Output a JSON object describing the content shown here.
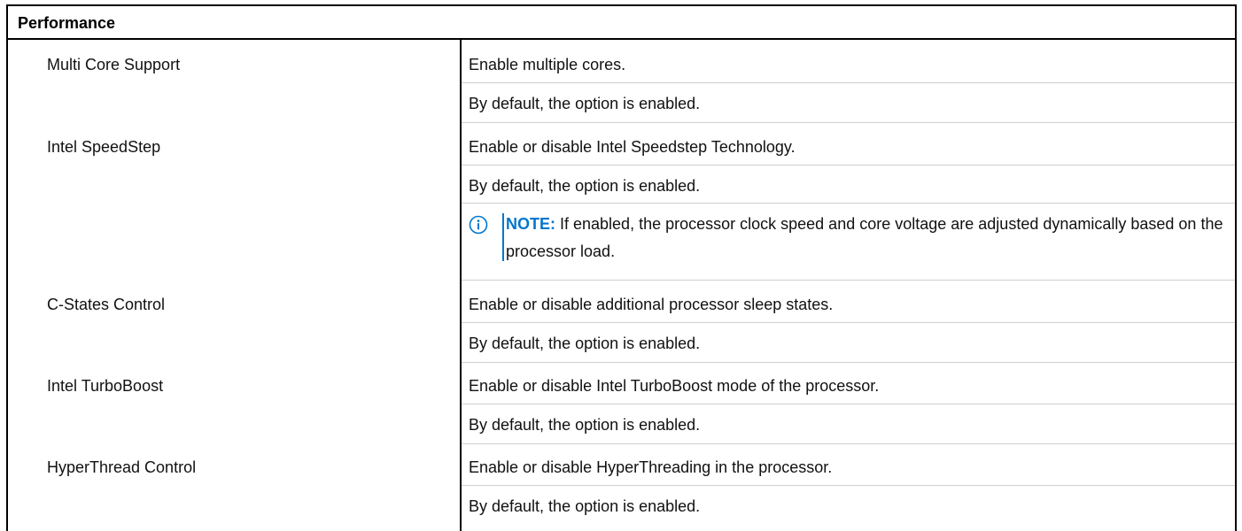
{
  "table": {
    "header": "Performance",
    "rows": [
      {
        "label": "Multi Core Support",
        "lines": [
          "Enable multiple cores.",
          "By default, the option is enabled."
        ]
      },
      {
        "label": "Intel SpeedStep",
        "lines": [
          "Enable or disable Intel Speedstep Technology.",
          "By default, the option is enabled."
        ],
        "note": {
          "icon": "info-circle-icon",
          "strong": "NOTE:",
          "text": " If enabled, the processor clock speed and core voltage are adjusted dynamically based on the processor load."
        }
      },
      {
        "label": "C-States Control",
        "lines": [
          "Enable or disable additional processor sleep states.",
          "By default, the option is enabled."
        ]
      },
      {
        "label": "Intel TurboBoost",
        "lines": [
          "Enable or disable Intel TurboBoost mode of the processor.",
          "By default, the option is enabled."
        ]
      },
      {
        "label": "HyperThread Control",
        "lines": [
          "Enable or disable HyperThreading in the processor.",
          "By default, the option is enabled."
        ]
      }
    ]
  },
  "colors": {
    "note_accent": "#0076ce",
    "border": "#000000",
    "row_rule": "#cfcfcf"
  }
}
